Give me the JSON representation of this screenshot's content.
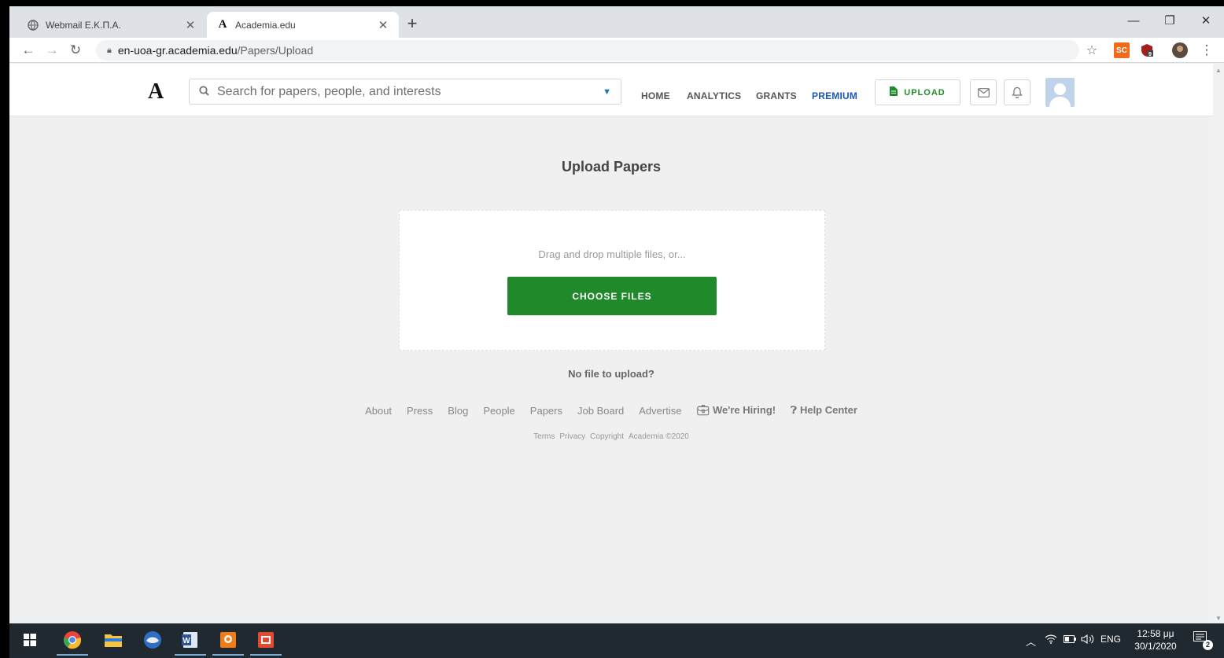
{
  "browser": {
    "tabs": [
      {
        "title": "Webmail Ε.Κ.Π.Α.",
        "active": false,
        "icon": "globe-icon"
      },
      {
        "title": "Academia.edu",
        "active": true,
        "icon": "academia-icon"
      }
    ],
    "url_host": "en-uoa-gr.academia.edu",
    "url_path": "/Papers/Upload",
    "extensions": [
      {
        "name": "sc-extension",
        "label": "SC",
        "color": "#f26a1b"
      },
      {
        "name": "shield-extension",
        "label": "9",
        "color": "#a51d1d"
      }
    ]
  },
  "header": {
    "logo": "A",
    "search_placeholder": "Search for papers, people, and interests",
    "nav": {
      "home": "HOME",
      "analytics": "ANALYTICS",
      "grants": "GRANTS",
      "premium": "PREMIUM"
    },
    "upload_label": "UPLOAD"
  },
  "main": {
    "title": "Upload Papers",
    "dropzone_hint": "Drag and drop multiple files, or...",
    "choose_files": "CHOOSE FILES",
    "no_file": "No file to upload?"
  },
  "footer": {
    "links": [
      "About",
      "Press",
      "Blog",
      "People",
      "Papers",
      "Job Board",
      "Advertise"
    ],
    "hiring": "We're Hiring!",
    "help": "Help Center",
    "legal": [
      "Terms",
      "Privacy",
      "Copyright",
      "Academia ©2020"
    ]
  },
  "taskbar": {
    "time": "12:58 μμ",
    "date": "30/1/2020",
    "language": "ENG",
    "notifications": "2"
  },
  "colors": {
    "brand_green": "#20892a",
    "premium_blue": "#1d57b5",
    "page_bg": "#f0f0f0"
  }
}
